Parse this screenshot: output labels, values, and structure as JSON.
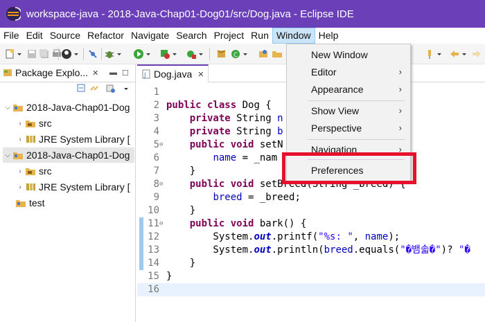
{
  "window": {
    "title": "workspace-java - 2018-Java-Chap01-Dog01/src/Dog.java - Eclipse IDE"
  },
  "menubar": {
    "items": [
      "File",
      "Edit",
      "Source",
      "Refactor",
      "Navigate",
      "Search",
      "Project",
      "Run",
      "Window",
      "Help"
    ],
    "active": "Window"
  },
  "window_menu": {
    "items": [
      {
        "label": "New Window",
        "submenu": false
      },
      {
        "label": "Editor",
        "submenu": true
      },
      {
        "label": "Appearance",
        "submenu": true
      },
      {
        "label": "Show View",
        "submenu": true
      },
      {
        "label": "Perspective",
        "submenu": true
      },
      {
        "label": "Navigation",
        "submenu": true
      },
      {
        "label": "Preferences",
        "submenu": false
      }
    ],
    "submenu_arrow": "›",
    "highlighted": "Preferences"
  },
  "package_explorer": {
    "tab_label": "Package Explo...",
    "tab_close": "✕",
    "tree": [
      {
        "label": "2018-Java-Chap01-Dog",
        "expanded": true,
        "icon": "project-icon",
        "level": 0
      },
      {
        "label": "src",
        "expanded": false,
        "icon": "source-folder-icon",
        "level": 1
      },
      {
        "label": "JRE System Library [",
        "expanded": false,
        "icon": "library-icon",
        "level": 1
      },
      {
        "label": "2018-Java-Chap01-Dog",
        "expanded": true,
        "icon": "project-icon",
        "level": 0,
        "selected": true
      },
      {
        "label": "src",
        "expanded": false,
        "icon": "source-folder-icon",
        "level": 1
      },
      {
        "label": "JRE System Library [",
        "expanded": false,
        "icon": "library-icon",
        "level": 1
      },
      {
        "label": "test",
        "expanded": null,
        "icon": "project-icon",
        "level": 0
      }
    ]
  },
  "editor": {
    "tab_label": "Dog.java",
    "tab_close": "✕",
    "lines": [
      {
        "n": "1",
        "html": ""
      },
      {
        "n": "2",
        "html": "<span class='kw'>public class</span> Dog {"
      },
      {
        "n": "3",
        "html": "    <span class='kw'>private</span> String <span class='fld'>n</span>"
      },
      {
        "n": "4",
        "html": "    <span class='kw'>private</span> String <span class='fld'>b</span>"
      },
      {
        "n": "5",
        "html": "    <span class='kw'>public void</span> setN"
      },
      {
        "n": "6",
        "html": "        <span class='fld'>name</span> = _nam"
      },
      {
        "n": "7",
        "html": "    }"
      },
      {
        "n": "8",
        "html": "    <span class='kw'>public void</span> setBreed(String _breed) {"
      },
      {
        "n": "9",
        "html": "        <span class='fld'>breed</span> = _breed;"
      },
      {
        "n": "10",
        "html": "    }"
      },
      {
        "n": "11",
        "html": "    <span class='kw'>public void</span> bark() {"
      },
      {
        "n": "12",
        "html": "        System.<span class='st'>out</span>.printf(<span class='str'>\"%s: \"</span>, <span class='fld'>name</span>);"
      },
      {
        "n": "13",
        "html": "        System.<span class='st'>out</span>.println(<span class='fld'>breed</span>.equals(<span class='str'>\"�뱀솗�\"</span>)? <span class='str'>\"�</span>"
      },
      {
        "n": "14",
        "html": "    }"
      },
      {
        "n": "15",
        "html": "}"
      },
      {
        "n": "16",
        "html": ""
      }
    ],
    "fold_lines": [
      "5",
      "8",
      "11"
    ],
    "current_line": "16"
  },
  "colors": {
    "titlebar": "#6a3fb8",
    "highlight_box": "#e8112d",
    "menu_active": "#cce4f7"
  }
}
